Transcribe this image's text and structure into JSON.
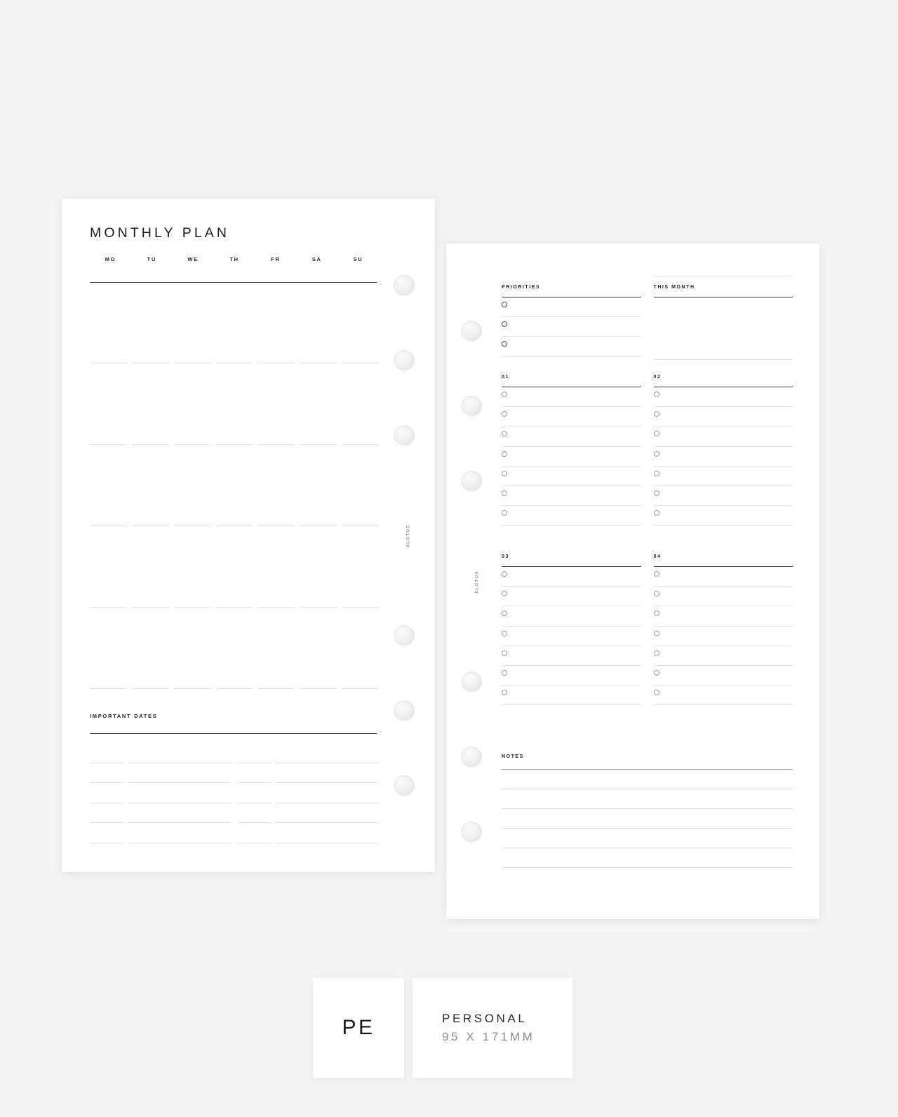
{
  "background_color": "#f4f4f4",
  "watermark_text": "8LOTUS",
  "left_page": {
    "title": "MONTHLY PLAN",
    "day_headers": [
      "MO",
      "TU",
      "WE",
      "TH",
      "FR",
      "SA",
      "SU"
    ],
    "week_row_count": 5,
    "important_dates": {
      "label": "IMPORTANT DATES",
      "row_count": 5,
      "columns": 2
    }
  },
  "right_page": {
    "priorities": {
      "label": "PRIORITIES",
      "item_count": 3
    },
    "this_month": {
      "label": "THIS MONTH"
    },
    "weeks": [
      {
        "label": "01",
        "item_count": 7
      },
      {
        "label": "02",
        "item_count": 7
      },
      {
        "label": "03",
        "item_count": 7
      },
      {
        "label": "04",
        "item_count": 7
      }
    ],
    "notes": {
      "label": "NOTES",
      "line_count": 5
    }
  },
  "size_cards": {
    "abbreviation": "PE",
    "name": "PERSONAL",
    "dimensions": "95 X 171MM"
  }
}
